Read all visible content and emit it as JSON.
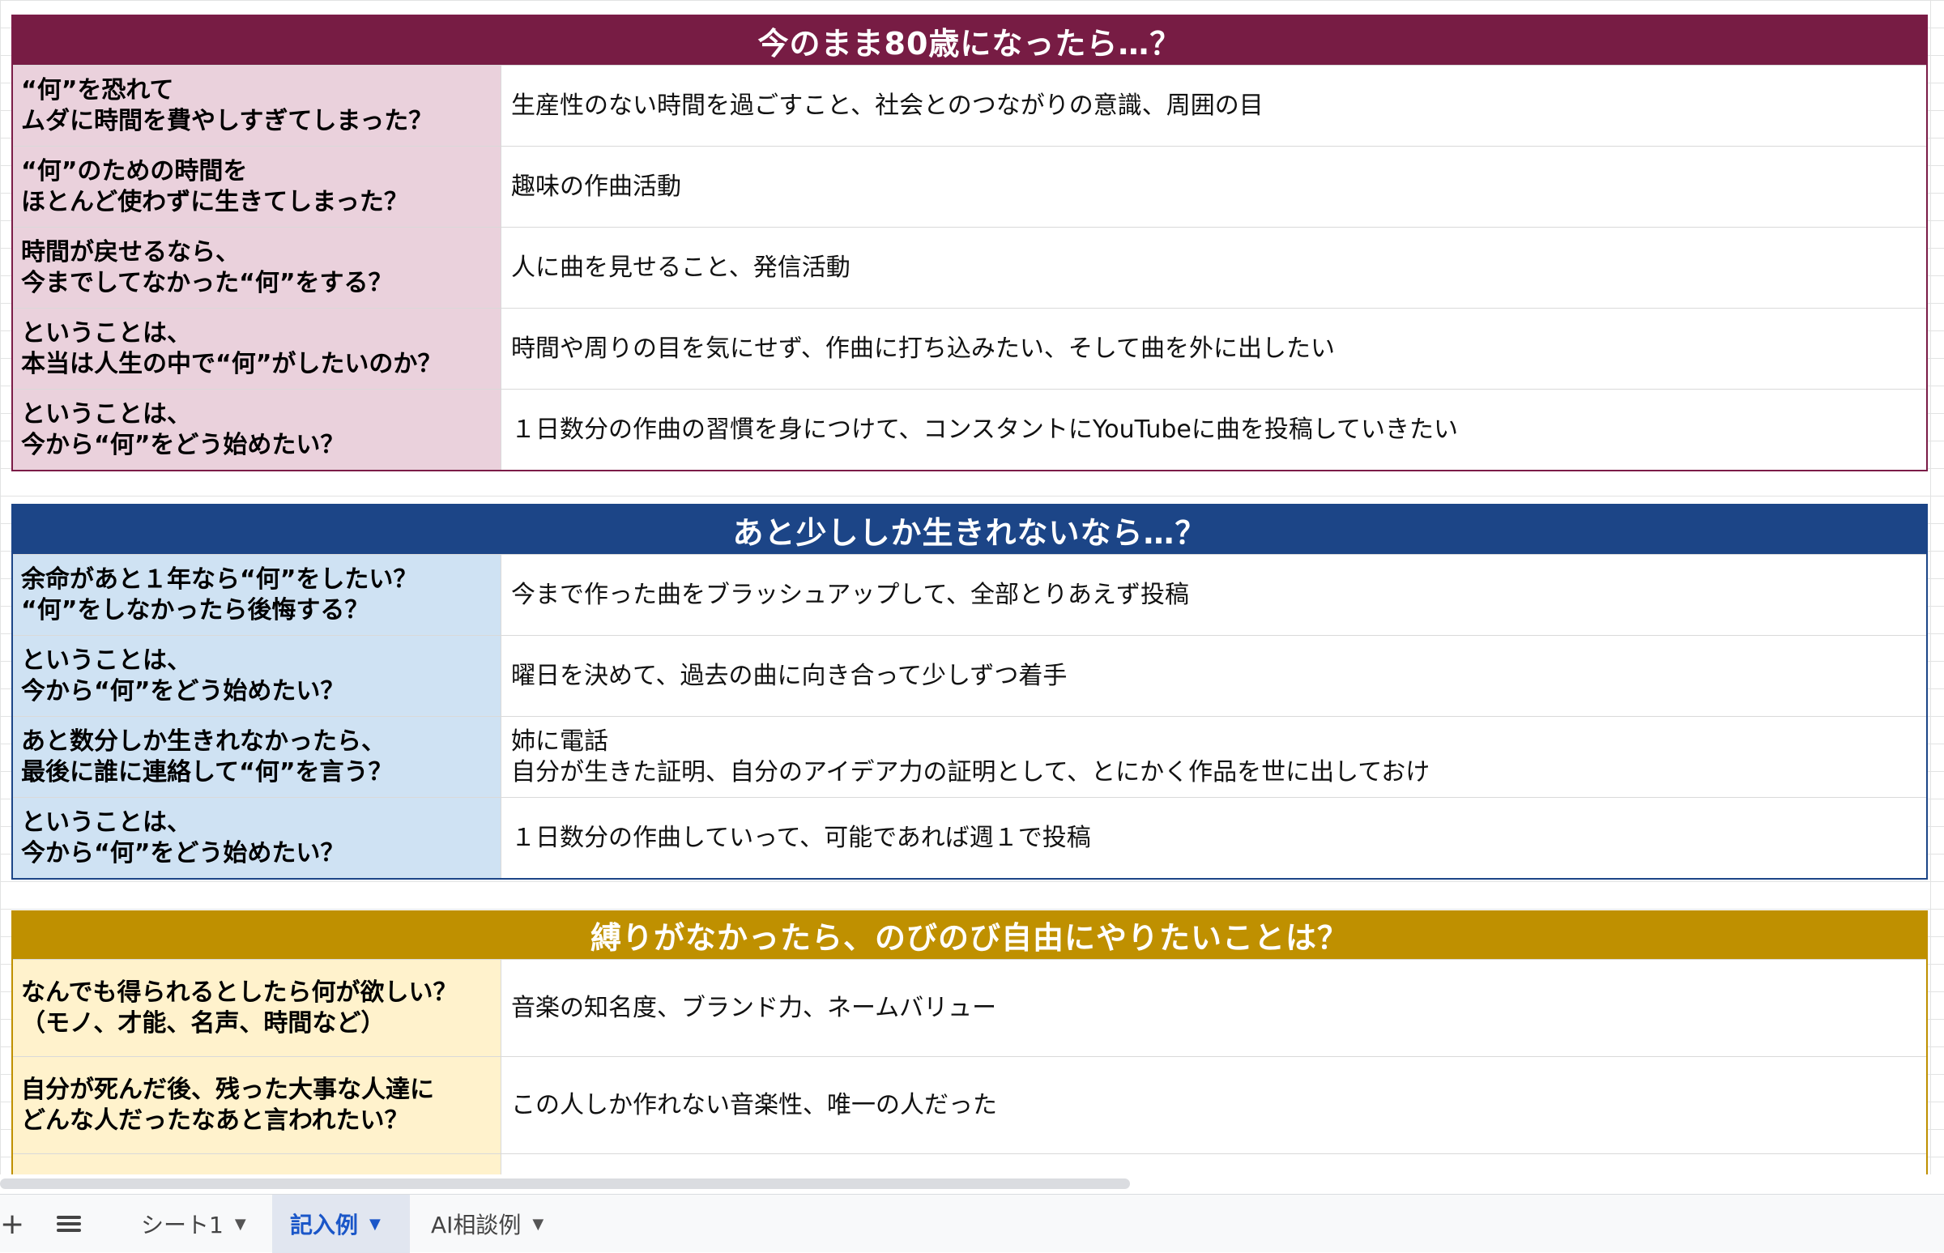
{
  "sections": [
    {
      "title": "今のまま80歳になったら…？",
      "rows": [
        {
          "q": "“何”を恐れて\nムダに時間を費やしすぎてしまった？",
          "a": "生産性のない時間を過ごすこと、社会とのつながりの意識、周囲の目"
        },
        {
          "q": "“何”のための時間を\nほとんど使わずに生きてしまった？",
          "a": "趣味の作曲活動"
        },
        {
          "q": "時間が戻せるなら、\n今までしてなかった“何”をする？",
          "a": "人に曲を見せること、発信活動"
        },
        {
          "q": "ということは、\n本当は人生の中で“何”がしたいのか？",
          "a": "時間や周りの目を気にせず、作曲に打ち込みたい、そして曲を外に出したい"
        },
        {
          "q": "ということは、\n今から“何”をどう始めたい？",
          "a": "１日数分の作曲の習慣を身につけて、コンスタントにYouTubeに曲を投稿していきたい"
        }
      ]
    },
    {
      "title": "あと少ししか生きれないなら…？",
      "rows": [
        {
          "q": "余命があと１年なら“何”をしたい？\n“何”をしなかったら後悔する？",
          "a": "今まで作った曲をブラッシュアップして、全部とりあえず投稿"
        },
        {
          "q": "ということは、\n今から“何”をどう始めたい？",
          "a": "曜日を決めて、過去の曲に向き合って少しずつ着手"
        },
        {
          "q": "あと数分しか生きれなかったら、\n最後に誰に連絡して“何”を言う？",
          "a": "姉に電話\n自分が生きた証明、自分のアイデア力の証明として、とにかく作品を世に出しておけ"
        },
        {
          "q": "ということは、\n今から“何”をどう始めたい？",
          "a": "１日数分の作曲していって、可能であれば週１で投稿"
        }
      ]
    },
    {
      "title": "縛りがなかったら、のびのび自由にやりたいことは？",
      "rows": [
        {
          "q": "なんでも得られるとしたら何が欲しい？\n（モノ、才能、名声、時間など）",
          "a": "音楽の知名度、ブランド力、ネームバリュー"
        },
        {
          "q": "自分が死んだ後、残った大事な人達に\nどんな人だったなあと言われたい？",
          "a": "この人しか作れない音楽性、唯一の人だった"
        }
      ]
    }
  ],
  "tabbar": {
    "add_icon": "+",
    "all_sheets_icon": "menu-icon",
    "tabs": [
      {
        "label": "シート1",
        "active": false
      },
      {
        "label": "記入例",
        "active": true
      },
      {
        "label": "AI相談例",
        "active": false
      }
    ],
    "dropdown_glyph": "▼"
  },
  "colors": {
    "section1": "#771c44",
    "section2": "#1c4587",
    "section3": "#bf9000",
    "section1_question_bg": "#ead1dc",
    "section2_question_bg": "#cfe2f3",
    "section3_question_bg": "#fff2cc",
    "active_tab": "#1a56c8"
  }
}
